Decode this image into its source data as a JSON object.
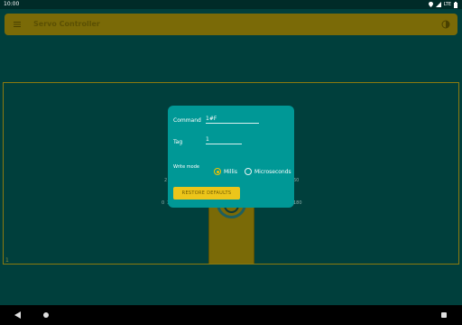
{
  "status_bar": {
    "time": "10:00",
    "network": "LTE",
    "icons": [
      "location-icon",
      "signal-icon",
      "lte-icon",
      "battery-icon"
    ]
  },
  "app_bar": {
    "title": "Servo Controller",
    "menu_icon": "hamburger-menu-icon",
    "theme_icon": "brightness-icon"
  },
  "panel": {
    "corner_label": "1",
    "scale_labels": {
      "left_top": "2",
      "left_bottom": "0",
      "left_bottom_2": "1",
      "right_top": "60",
      "right_bottom": "180"
    }
  },
  "dialog": {
    "command_label": "Command",
    "command_value": "1#F",
    "tag_label": "Tag",
    "tag_value": "1",
    "write_mode_label": "Write mode",
    "options": [
      {
        "label": "Millis",
        "checked": true
      },
      {
        "label": "Microseconds",
        "checked": false
      }
    ],
    "restore_button": "RESTORE DEFAULTS"
  },
  "colors": {
    "background": "#003f3c",
    "app_bar": "#7a6a07",
    "dialog": "#009896",
    "accent": "#ecc51a"
  },
  "nav_bar": {
    "icons": [
      "back-icon",
      "home-icon",
      "recents-icon"
    ]
  }
}
